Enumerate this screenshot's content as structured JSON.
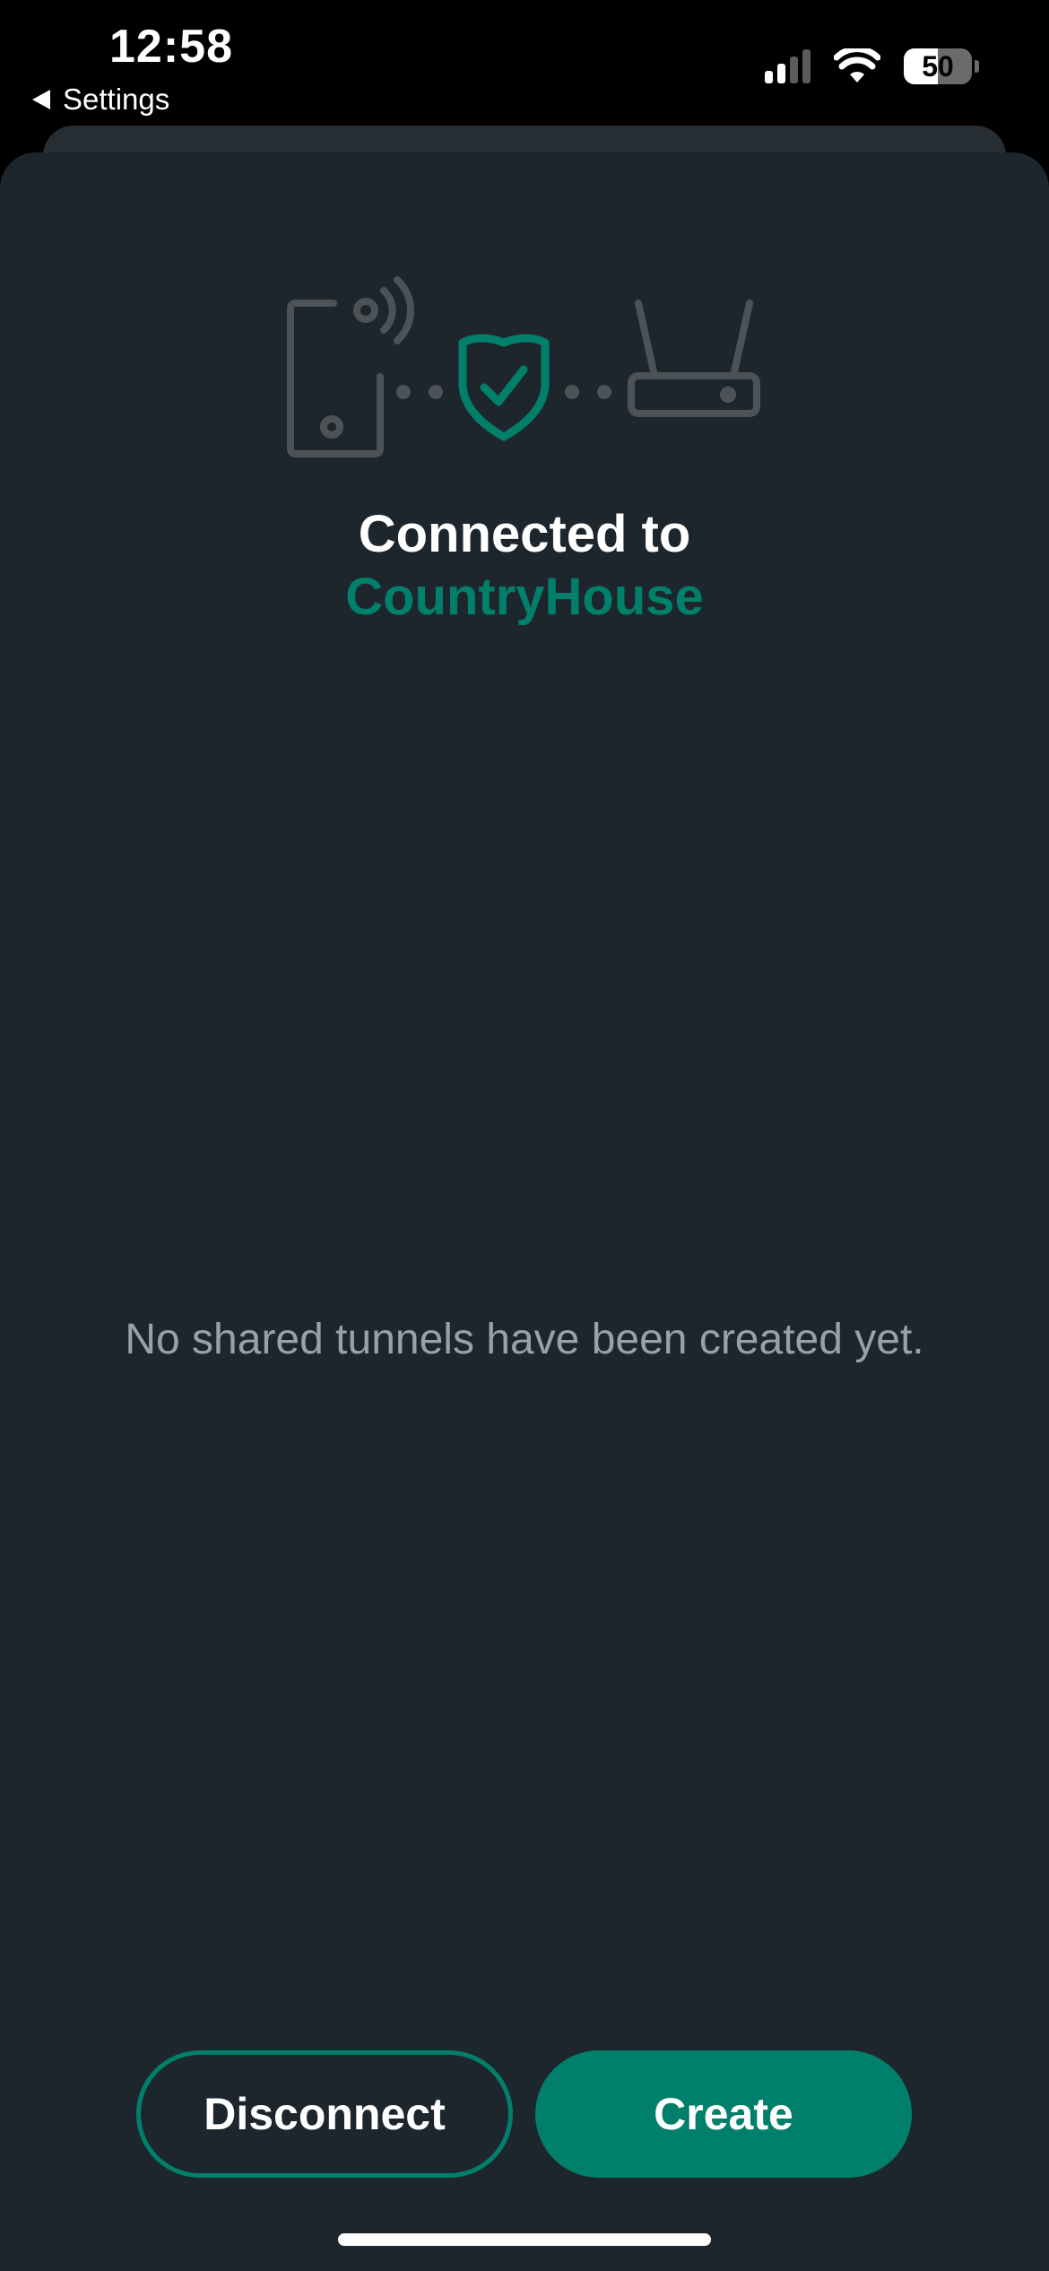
{
  "status_bar": {
    "time": "12:58",
    "back_label": "Settings",
    "battery_level": "50",
    "battery_fraction": 0.5,
    "signal_bars_active": 2,
    "signal_bars_total": 4
  },
  "illustration": {
    "icons": [
      "phone-wireless-icon",
      "shield-check-icon",
      "router-icon"
    ],
    "accent_color": "#00806a",
    "muted_color": "#4c5256"
  },
  "status": {
    "title": "Connected to",
    "network_name": "CountryHouse"
  },
  "empty_state": {
    "message": "No shared tunnels have been created yet."
  },
  "actions": {
    "disconnect_label": "Disconnect",
    "create_label": "Create"
  },
  "colors": {
    "accent": "#00806a",
    "background": "#1e262d",
    "muted_text": "#9aa1a6"
  }
}
